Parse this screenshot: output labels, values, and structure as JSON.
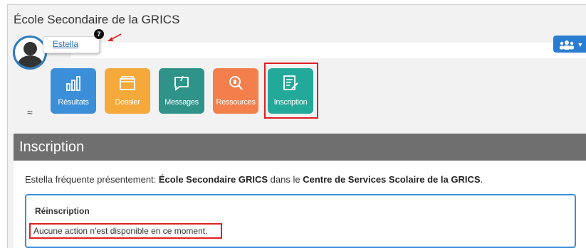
{
  "school": {
    "title": "École Secondaire de la GRICS"
  },
  "user": {
    "name": "Estella",
    "notification_count": "7"
  },
  "toolbar": {
    "group_icon": "group-icon"
  },
  "tiles": [
    {
      "label": "Résultats",
      "icon": "bar-chart-icon",
      "color": "#3a8fd8"
    },
    {
      "label": "Dossier",
      "icon": "folder-icon",
      "color": "#f4a93a"
    },
    {
      "label": "Messages",
      "icon": "message-icon",
      "color": "#2f9389"
    },
    {
      "label": "Ressources",
      "icon": "resources-icon",
      "color": "#f27f4c"
    },
    {
      "label": "Inscription",
      "icon": "form-icon",
      "color": "#22a99a"
    }
  ],
  "section": {
    "title": "Inscription",
    "sentence_prefix": "Estella fréquente présentement: ",
    "school_name": "École Secondaire GRICS",
    "sentence_middle": " dans le ",
    "service_center": "Centre de Services Scolaire de la GRICS",
    "sentence_suffix": "."
  },
  "reinscription": {
    "title": "Réinscription",
    "message": "Aucune action n'est disponible en ce moment."
  },
  "colors": {
    "highlight": "#e02020",
    "accent": "#3a8fd8",
    "header": "#6f6f6f"
  }
}
